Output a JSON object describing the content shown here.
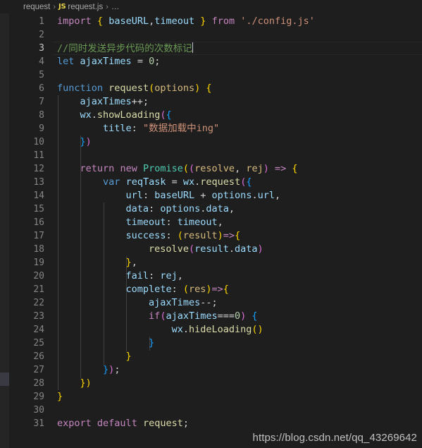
{
  "window": {
    "theme": "vscode-dark",
    "background_color": "#1e1e1e",
    "gutter_color": "#858585",
    "active_line_number_color": "#c6c6c6"
  },
  "breadcrumb": {
    "folder": "request",
    "separator": "›",
    "file_icon_label": "JS",
    "file": "request.js",
    "ellipsis": "…"
  },
  "editor": {
    "active_line": 3,
    "total_lines": 31,
    "line_numbers": [
      1,
      2,
      3,
      4,
      5,
      6,
      7,
      8,
      9,
      10,
      11,
      12,
      13,
      14,
      15,
      16,
      17,
      18,
      19,
      20,
      21,
      22,
      23,
      24,
      25,
      26,
      27,
      28,
      29,
      30,
      31
    ],
    "lines": [
      {
        "n": 1,
        "text": "import { baseURL,timeout } from './config.js'"
      },
      {
        "n": 2,
        "text": ""
      },
      {
        "n": 3,
        "text": "//同时发送异步代码的次数标记"
      },
      {
        "n": 4,
        "text": "let ajaxTimes = 0;"
      },
      {
        "n": 5,
        "text": ""
      },
      {
        "n": 6,
        "text": "function request(options) {"
      },
      {
        "n": 7,
        "text": "    ajaxTimes++;"
      },
      {
        "n": 8,
        "text": "    wx.showLoading({"
      },
      {
        "n": 9,
        "text": "        title: \"数据加载中ing\""
      },
      {
        "n": 10,
        "text": "    })"
      },
      {
        "n": 11,
        "text": ""
      },
      {
        "n": 12,
        "text": "    return new Promise((resolve, rej) => {"
      },
      {
        "n": 13,
        "text": "        var reqTask = wx.request({"
      },
      {
        "n": 14,
        "text": "            url: baseURL + options.url,"
      },
      {
        "n": 15,
        "text": "            data: options.data,"
      },
      {
        "n": 16,
        "text": "            timeout: timeout,"
      },
      {
        "n": 17,
        "text": "            success: (result)=>{"
      },
      {
        "n": 18,
        "text": "                resolve(result.data)"
      },
      {
        "n": 19,
        "text": "            },"
      },
      {
        "n": 20,
        "text": "            fail: rej,"
      },
      {
        "n": 21,
        "text": "            complete: (res)=>{"
      },
      {
        "n": 22,
        "text": "                ajaxTimes--;"
      },
      {
        "n": 23,
        "text": "                if(ajaxTimes===0) {"
      },
      {
        "n": 24,
        "text": "                    wx.hideLoading()"
      },
      {
        "n": 25,
        "text": "                }"
      },
      {
        "n": 26,
        "text": "            }"
      },
      {
        "n": 27,
        "text": "        });"
      },
      {
        "n": 28,
        "text": "    })"
      },
      {
        "n": 29,
        "text": "}"
      },
      {
        "n": 30,
        "text": ""
      },
      {
        "n": 31,
        "text": "export default request;"
      }
    ]
  },
  "watermark": {
    "text": "https://blog.csdn.net/qq_43269642"
  }
}
